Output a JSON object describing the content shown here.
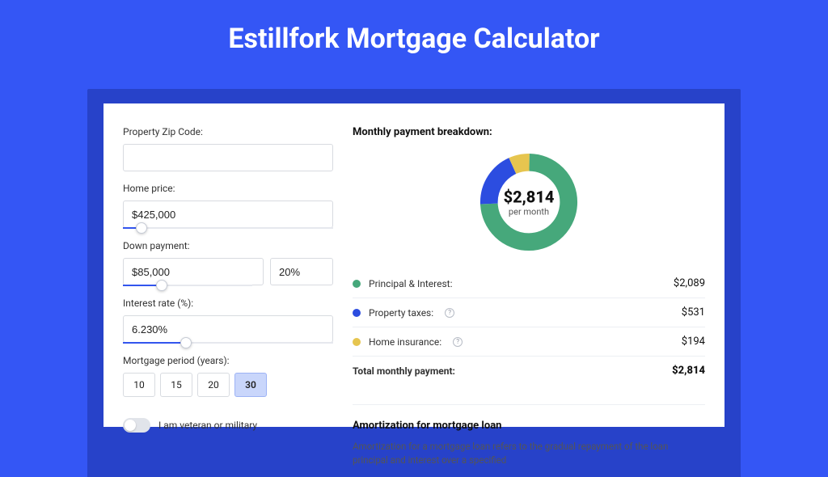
{
  "title": "Estillfork Mortgage Calculator",
  "left": {
    "zip_label": "Property Zip Code:",
    "zip_value": "",
    "home_label": "Home price:",
    "home_value": "$425,000",
    "home_slider_pct": 9,
    "down_label": "Down payment:",
    "down_value": "$85,000",
    "down_pct": "20%",
    "down_slider_pct": 20,
    "rate_label": "Interest rate (%):",
    "rate_value": "6.230%",
    "rate_slider_pct": 30,
    "period_label": "Mortgage period (years):",
    "periods": [
      "10",
      "15",
      "20",
      "30"
    ],
    "period_active": "30",
    "veteran_label": "I am veteran or military"
  },
  "right": {
    "breakdown_title": "Monthly payment breakdown:",
    "donut_amount": "$2,814",
    "donut_sub": "per month",
    "items": [
      {
        "label": "Principal & Interest:",
        "value": "$2,089",
        "color": "green",
        "info": false
      },
      {
        "label": "Property taxes:",
        "value": "$531",
        "color": "blue",
        "info": true
      },
      {
        "label": "Home insurance:",
        "value": "$194",
        "color": "yellow",
        "info": true
      }
    ],
    "total_label": "Total monthly payment:",
    "total_value": "$2,814",
    "amort_title": "Amortization for mortgage loan",
    "amort_text": "Amortization for a mortgage loan refers to the gradual repayment of the loan principal and interest over a specified"
  },
  "chart_data": {
    "type": "pie",
    "title": "Monthly payment breakdown",
    "series": [
      {
        "name": "Principal & Interest",
        "value": 2089,
        "color": "#46a87b"
      },
      {
        "name": "Property taxes",
        "value": 531,
        "color": "#2c4de0"
      },
      {
        "name": "Home insurance",
        "value": 194,
        "color": "#e6c54f"
      }
    ],
    "total": 2814
  }
}
